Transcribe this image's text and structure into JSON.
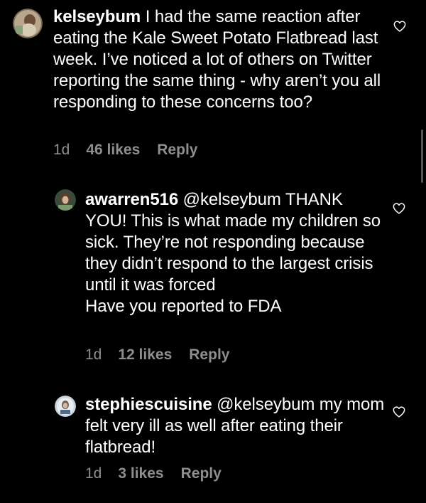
{
  "comments": [
    {
      "username": "kelseybum",
      "text": " I had the same reaction after eating the Kale Sweet Potato Flatbread last week. I’ve noticed a lot of others on Twitter reporting the same thing - why aren’t you all responding to these concerns too?",
      "extra": "",
      "time": "1d",
      "likes": "46 likes",
      "reply": "Reply"
    },
    {
      "username": "awarren516",
      "text": " @kelseybum THANK YOU! This is what made my children so sick. They’re not responding because they didn’t respond to the largest crisis until it was forced",
      "extra": "Have you reported to FDA",
      "time": "1d",
      "likes": "12 likes",
      "reply": "Reply"
    },
    {
      "username": "stephiescuisine",
      "text": " @kelseybum my mom felt very ill as well after eating their flatbread!",
      "extra": "",
      "time": "1d",
      "likes": "3 likes",
      "reply": "Reply"
    }
  ],
  "icons": {
    "like": "heart-outline-icon"
  },
  "colors": {
    "background": "#000000",
    "text": "#ffffff",
    "meta": "#8e8e8e"
  }
}
